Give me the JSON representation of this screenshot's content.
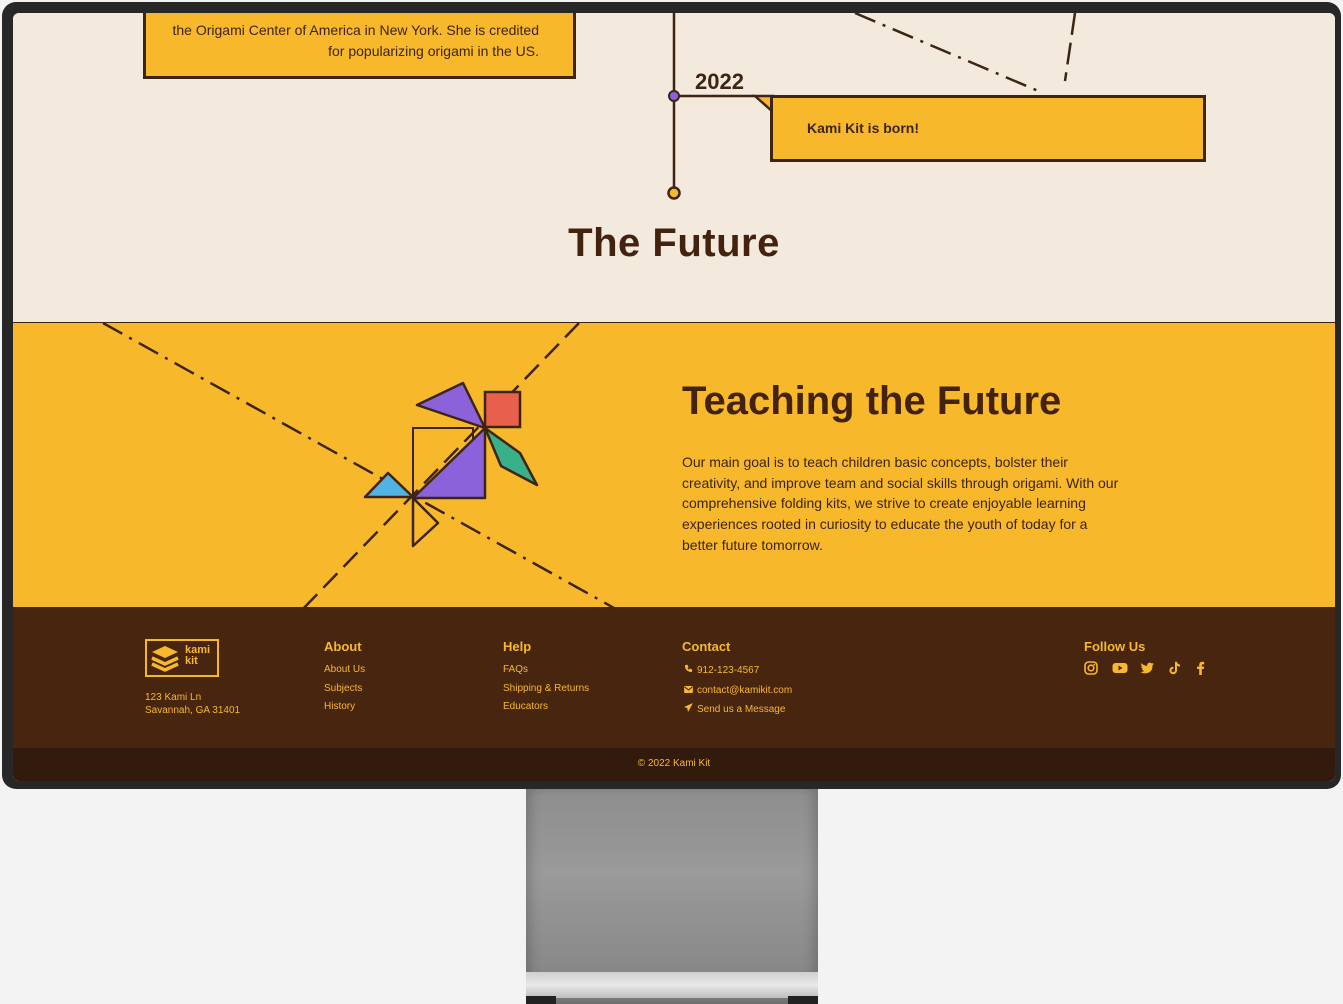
{
  "timeline": {
    "card1_lines": [
      "the Origami Center of America in New York. She is credited",
      "for popularizing origami in the US."
    ],
    "year": "2022",
    "card2_text": "Kami Kit is born!"
  },
  "future": {
    "title": "The Future"
  },
  "teaching": {
    "title": "Teaching the Future",
    "body": "Our main goal is to teach children basic concepts, bolster their creativity, and improve team and social skills through origami. With our comprehensive folding kits, we strive to create enjoyable learning experiences rooted in curiosity to educate the youth of today for a better future tomorrow."
  },
  "footer": {
    "logo": {
      "line1": "kami",
      "line2": "kit"
    },
    "address": [
      "123 Kami Ln",
      "Savannah, GA 31401"
    ],
    "about": {
      "heading": "About",
      "links": [
        "About Us",
        "Subjects",
        "History"
      ]
    },
    "help": {
      "heading": "Help",
      "links": [
        "FAQs",
        "Shipping & Returns",
        "Educators"
      ]
    },
    "contact": {
      "heading": "Contact",
      "items": [
        {
          "icon": "phone-icon",
          "text": "912-123-4567"
        },
        {
          "icon": "envelope-icon",
          "text": "contact@kamikit.com"
        },
        {
          "icon": "paper-plane-icon",
          "text": "Send us a Message"
        }
      ]
    },
    "follow": {
      "heading": "Follow Us",
      "icons": [
        "instagram-icon",
        "youtube-icon",
        "twitter-icon",
        "tiktok-icon",
        "facebook-icon"
      ]
    },
    "copyright": "© 2022 Kami Kit"
  },
  "colors": {
    "accent": "#f8b82c",
    "brown": "#47250f",
    "cream": "#f3e9dc",
    "purple": "#8b62d9",
    "red": "#e8604c",
    "green": "#38b08a",
    "blue": "#4fb3e3"
  }
}
